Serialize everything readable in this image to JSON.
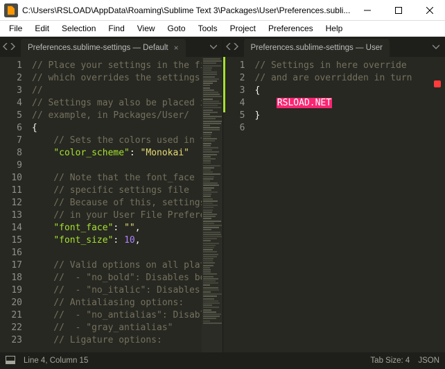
{
  "window": {
    "title": "C:\\Users\\RSLOAD\\AppData\\Roaming\\Sublime Text 3\\Packages\\User\\Preferences.subli..."
  },
  "menu": {
    "items": [
      "File",
      "Edit",
      "Selection",
      "Find",
      "View",
      "Goto",
      "Tools",
      "Project",
      "Preferences",
      "Help"
    ]
  },
  "leftPane": {
    "tab": {
      "label": "Preferences.sublime-settings — Default",
      "close": "×"
    },
    "code": {
      "firstLine": 1,
      "lines": [
        {
          "t": "comment",
          "s": "// Place your settings in the file"
        },
        {
          "t": "comment",
          "s": "// which overrides the settings in"
        },
        {
          "t": "comment",
          "s": "//"
        },
        {
          "t": "comment",
          "s": "// Settings may also be placed in"
        },
        {
          "t": "comment",
          "s": "// example, in Packages/User/"
        },
        {
          "t": "punct",
          "s": "{"
        },
        {
          "t": "comment",
          "s": "    // Sets the colors used in the"
        },
        {
          "t": "kv",
          "key": "\"color_scheme\"",
          "sep": ": ",
          "val": "\"Monokai\""
        },
        {
          "t": "blank",
          "s": ""
        },
        {
          "t": "comment",
          "s": "    // Note that the font_face"
        },
        {
          "t": "comment",
          "s": "    // specific settings file"
        },
        {
          "t": "comment",
          "s": "    // Because of this, settings"
        },
        {
          "t": "comment",
          "s": "    // in your User File Preferences"
        },
        {
          "t": "kv",
          "key": "\"font_face\"",
          "sep": ": ",
          "val": "\"\"",
          "tail": ","
        },
        {
          "t": "kvnum",
          "key": "\"font_size\"",
          "sep": ": ",
          "val": "10",
          "tail": ","
        },
        {
          "t": "blank",
          "s": ""
        },
        {
          "t": "comment",
          "s": "    // Valid options on all platforms"
        },
        {
          "t": "comment",
          "s": "    //  - \"no_bold\": Disables bold"
        },
        {
          "t": "comment",
          "s": "    //  - \"no_italic\": Disables"
        },
        {
          "t": "comment",
          "s": "    // Antialiasing options:"
        },
        {
          "t": "comment",
          "s": "    //  - \"no_antialias\": Disables"
        },
        {
          "t": "comment",
          "s": "    //  - \"gray_antialias\""
        },
        {
          "t": "comment",
          "s": "    // Ligature options:"
        }
      ]
    }
  },
  "rightPane": {
    "tab": {
      "label": "Preferences.sublime-settings — User"
    },
    "code": {
      "firstLine": 1,
      "lines": [
        {
          "t": "comment",
          "s": "// Settings in here override"
        },
        {
          "t": "comment",
          "s": "// and are overridden in turn"
        },
        {
          "t": "punct",
          "s": "{"
        },
        {
          "t": "hl",
          "prefix": "    ",
          "s": "RSLOAD.NET"
        },
        {
          "t": "punct",
          "s": "}"
        },
        {
          "t": "blank",
          "s": ""
        }
      ]
    }
  },
  "status": {
    "pos": "Line 4, Column 15",
    "tab": "Tab Size: 4",
    "syntax": "JSON"
  }
}
